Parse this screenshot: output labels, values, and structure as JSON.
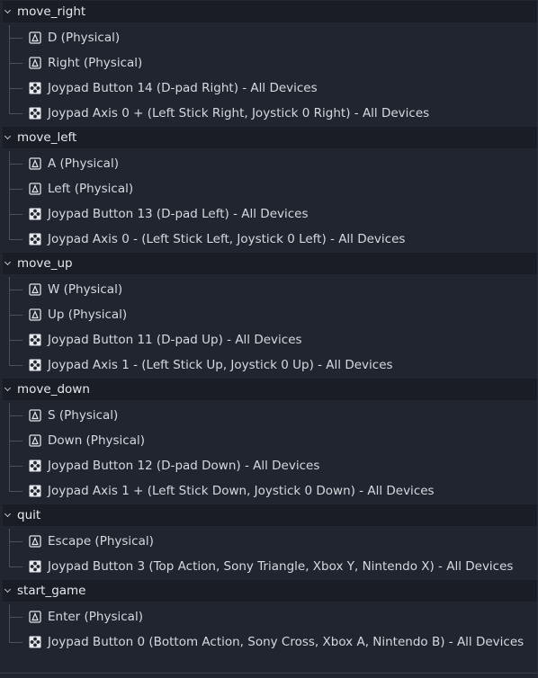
{
  "actions": [
    {
      "name": "move_right",
      "events": [
        {
          "label": "D (Physical)",
          "icon": "keyboard-icon"
        },
        {
          "label": "Right (Physical)",
          "icon": "keyboard-icon"
        },
        {
          "label": "Joypad Button 14 (D-pad Right) - All Devices",
          "icon": "joypad-icon"
        },
        {
          "label": "Joypad Axis 0 + (Left Stick Right, Joystick 0 Right) - All Devices",
          "icon": "joypad-icon"
        }
      ]
    },
    {
      "name": "move_left",
      "events": [
        {
          "label": "A (Physical)",
          "icon": "keyboard-icon"
        },
        {
          "label": "Left (Physical)",
          "icon": "keyboard-icon"
        },
        {
          "label": "Joypad Button 13 (D-pad Left) - All Devices",
          "icon": "joypad-icon"
        },
        {
          "label": "Joypad Axis 0 - (Left Stick Left, Joystick 0 Left) - All Devices",
          "icon": "joypad-icon"
        }
      ]
    },
    {
      "name": "move_up",
      "events": [
        {
          "label": "W (Physical)",
          "icon": "keyboard-icon"
        },
        {
          "label": "Up (Physical)",
          "icon": "keyboard-icon"
        },
        {
          "label": "Joypad Button 11 (D-pad Up) - All Devices",
          "icon": "joypad-icon"
        },
        {
          "label": "Joypad Axis 1 - (Left Stick Up, Joystick 0 Up) - All Devices",
          "icon": "joypad-icon"
        }
      ]
    },
    {
      "name": "move_down",
      "events": [
        {
          "label": "S (Physical)",
          "icon": "keyboard-icon"
        },
        {
          "label": "Down (Physical)",
          "icon": "keyboard-icon"
        },
        {
          "label": "Joypad Button 12 (D-pad Down) - All Devices",
          "icon": "joypad-icon"
        },
        {
          "label": "Joypad Axis 1 + (Left Stick Down, Joystick 0 Down) - All Devices",
          "icon": "joypad-icon"
        }
      ]
    },
    {
      "name": "quit",
      "events": [
        {
          "label": "Escape (Physical)",
          "icon": "keyboard-icon"
        },
        {
          "label": "Joypad Button 3 (Top Action, Sony Triangle, Xbox Y, Nintendo X) - All Devices",
          "icon": "joypad-icon"
        }
      ]
    },
    {
      "name": "start_game",
      "events": [
        {
          "label": "Enter (Physical)",
          "icon": "keyboard-icon"
        },
        {
          "label": "Joypad Button 0 (Bottom Action, Sony Cross, Xbox A, Nintendo B) - All Devices",
          "icon": "joypad-icon"
        }
      ]
    }
  ]
}
